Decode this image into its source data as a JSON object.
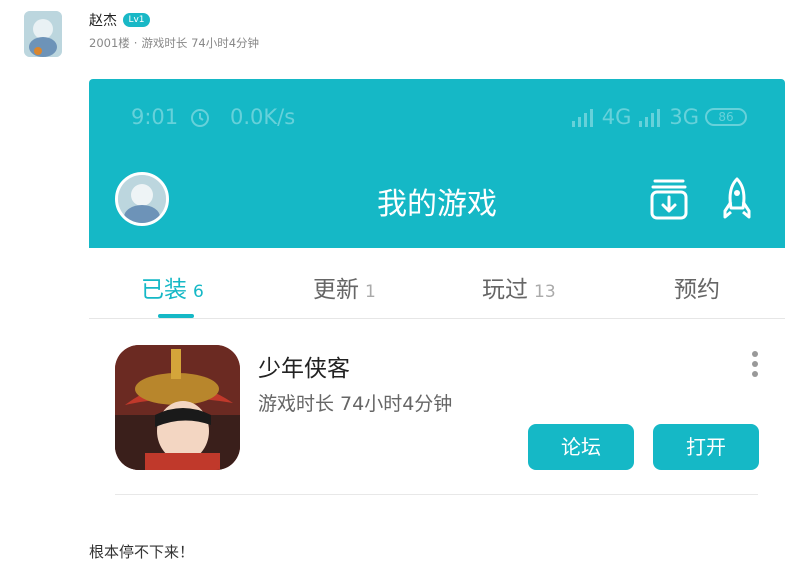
{
  "post": {
    "author_name": "赵杰",
    "level": "Lv1",
    "floor": "2001楼",
    "meta_separator": "·",
    "playtime": "游戏时长 74小时4分钟",
    "comment": "根本停不下来！"
  },
  "screenshot": {
    "status_bar": {
      "time": "9:01",
      "speed": "0.0K/s",
      "network1": "4G",
      "network2": "3G",
      "battery": "86",
      "alarm_icon": "alarm-clock-icon",
      "signal_icon": "signal-bars-icon"
    },
    "header": {
      "title": "我的游戏",
      "download_icon": "download-manager-icon",
      "rocket_icon": "rocket-icon"
    },
    "tabs": [
      {
        "label": "已装",
        "count": "6",
        "active": true
      },
      {
        "label": "更新",
        "count": "1",
        "active": false
      },
      {
        "label": "玩过",
        "count": "13",
        "active": false
      },
      {
        "label": "预约",
        "count": "",
        "active": false
      }
    ],
    "game": {
      "name": "少年侠客",
      "playtime": "游戏时长 74小时4分钟",
      "forum_button": "论坛",
      "open_button": "打开",
      "more_icon": "more-vertical-icon"
    },
    "colors": {
      "accent": "#15b8c6",
      "badge": "#19b8c6"
    }
  }
}
